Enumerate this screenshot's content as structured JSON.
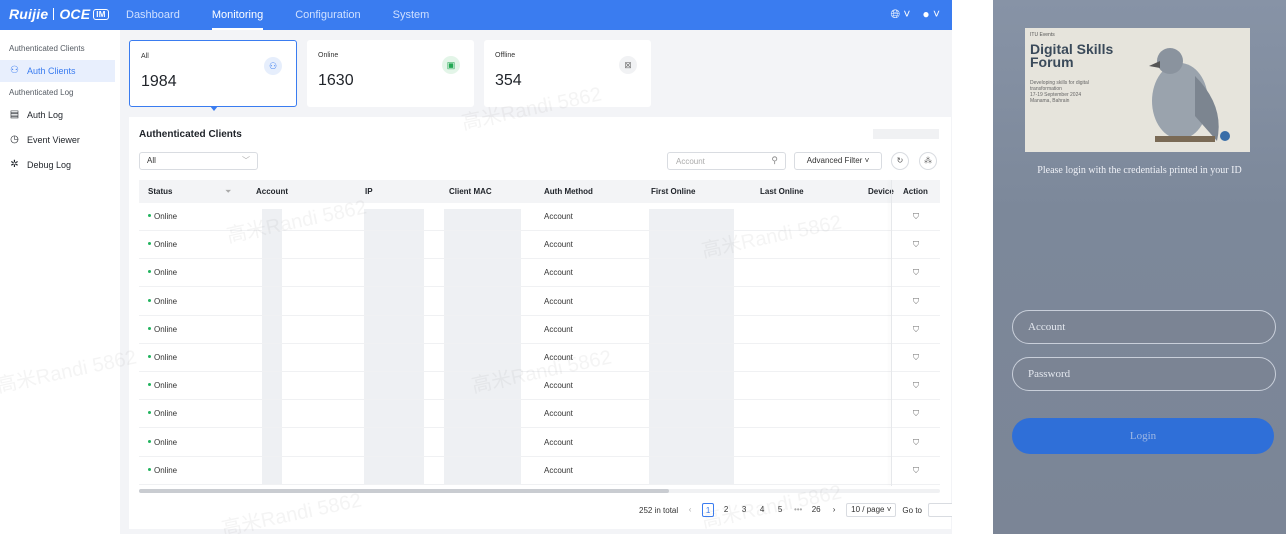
{
  "topbar": {
    "logo_brand": "Ruijie",
    "logo_product": "OCE",
    "logo_badge": "IM",
    "nav": [
      "Dashboard",
      "Monitoring",
      "Configuration",
      "System"
    ],
    "active_nav": "Monitoring",
    "globe_icon": "globe-icon",
    "user_icon": "user-icon"
  },
  "sidebar": {
    "group1": "Authenticated Clients",
    "item_auth_clients": "Auth Clients",
    "group2": "Authenticated Log",
    "item_auth_log": "Auth Log",
    "item_event_viewer": "Event Viewer",
    "item_debug_log": "Debug Log"
  },
  "cards": {
    "all": {
      "label": "All",
      "value": "1984"
    },
    "online": {
      "label": "Online",
      "value": "1630"
    },
    "offline": {
      "label": "Offline",
      "value": "354"
    }
  },
  "panel": {
    "title": "Authenticated Clients",
    "filter_select": "All",
    "search_placeholder": "Account",
    "advanced_filter": "Advanced Filter"
  },
  "table": {
    "columns": [
      "Status",
      "Account",
      "IP",
      "Client MAC",
      "Auth Method",
      "First Online",
      "Last Online",
      "Device",
      "Action"
    ],
    "rows": [
      {
        "status": "Online",
        "auth_method": "Account"
      },
      {
        "status": "Online",
        "auth_method": "Account"
      },
      {
        "status": "Online",
        "auth_method": "Account"
      },
      {
        "status": "Online",
        "auth_method": "Account"
      },
      {
        "status": "Online",
        "auth_method": "Account"
      },
      {
        "status": "Online",
        "auth_method": "Account"
      },
      {
        "status": "Online",
        "auth_method": "Account"
      },
      {
        "status": "Online",
        "auth_method": "Account"
      },
      {
        "status": "Online",
        "auth_method": "Account"
      },
      {
        "status": "Online",
        "auth_method": "Account"
      }
    ]
  },
  "pagination": {
    "total": "252 in total",
    "pages": [
      "1",
      "2",
      "3",
      "4",
      "5"
    ],
    "ellipsis": "•••",
    "last_page": "26",
    "page_size": "10 / page",
    "goto_label": "Go to"
  },
  "watermark": "高米Randi 5862",
  "photo": {
    "poster_tag": "ITU Events",
    "poster_title_1": "Digital Skills",
    "poster_title_2": "Forum",
    "poster_sub": "Developing skills for digital transformation",
    "poster_date": "17-19 September 2024",
    "poster_place": "Manama, Bahrain",
    "message": "Please login with the credentials printed in your ID",
    "account_placeholder": "Account",
    "password_placeholder": "Password",
    "login_label": "Login"
  }
}
